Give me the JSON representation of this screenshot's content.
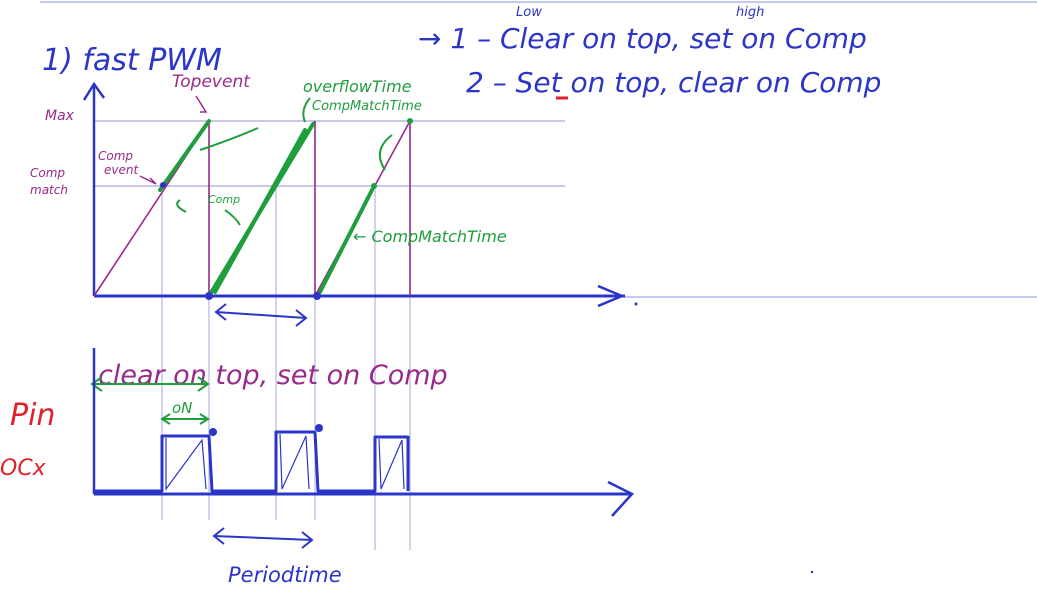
{
  "colors": {
    "ink_blue": "#2b35c8",
    "ink_purple": "#9a2a8a",
    "ink_green": "#1f9e3c",
    "ink_red": "#e0202a",
    "guide": "#b9b6e0",
    "baseline": "#8a8fe0"
  },
  "heading": {
    "title": "1) fast PWM",
    "mode1": "→ 1 – Clear on top, set on Comp",
    "mode1_low": "Low",
    "mode1_high": "high",
    "mode2": "2 – Set on top, clear on Comp"
  },
  "axis_labels": {
    "max": "Max",
    "comp_match_line1": "Comp",
    "comp_match_line2": "match"
  },
  "annotations": {
    "top_event": "Topevent",
    "comp_event_line1": "Comp",
    "comp_event_line2": "event",
    "overflow_time": "overflowTime",
    "comp_match_time_top": "CompMatchTime",
    "comp_small": "Comp",
    "comp_match_time_right": "← CompMatchTime"
  },
  "waveform": {
    "label": "clear on top, set on Comp",
    "on_label": "oN",
    "pin_line1": "Pin",
    "pin_line2": "OCx"
  },
  "period_label": "Periodtime"
}
